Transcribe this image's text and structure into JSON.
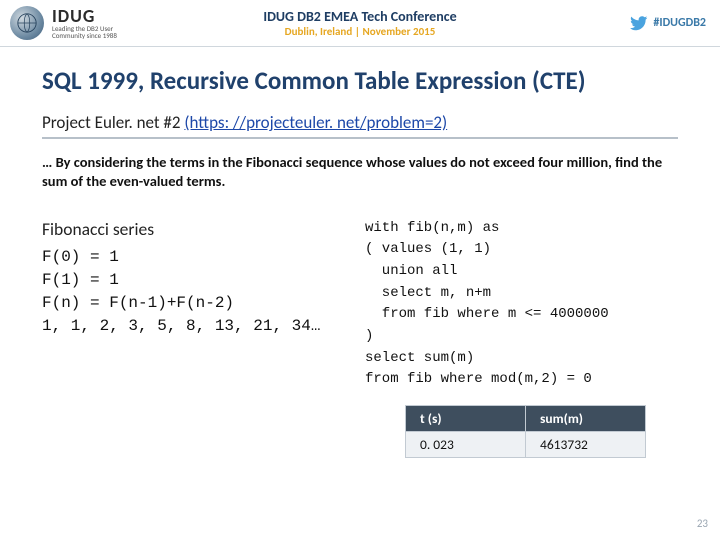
{
  "header": {
    "logo_big": "IDUG",
    "logo_sub1": "Leading the DB2 User",
    "logo_sub2": "Community since 1988",
    "title": "IDUG DB2 EMEA Tech Conference",
    "subtitle": "Dublin, Ireland  |  November 2015",
    "hashtag": "#IDUGDB2"
  },
  "main": {
    "h1": "SQL 1999, Recursive Common Table Expression (CTE)",
    "subtitle_prefix": "Project Euler. net #2 ",
    "link_text": "(https: //projecteuler. net/problem=2)",
    "problem": "… By considering the terms in the Fibonacci sequence whose values do not exceed four million, find the sum of the even-valued terms.",
    "fib_title": "Fibonacci series",
    "fib_lines": "F(0) = 1\nF(1) = 1\nF(n) = F(n-1)+F(n-2)\n1, 1, 2, 3, 5, 8, 13, 21, 34…",
    "sql": "with fib(n,m) as\n( values (1, 1)\n  union all\n  select m, n+m\n  from fib where m <= 4000000\n)\nselect sum(m)\nfrom fib where mod(m,2) = 0"
  },
  "result": {
    "h1": "t (s)",
    "h2": "sum(m)",
    "c1": "0. 023",
    "c2": "4613732"
  },
  "footer": {
    "page": "23"
  },
  "chart_data": {
    "type": "table",
    "title": "Recursive CTE Fibonacci even-sum result",
    "columns": [
      "t (s)",
      "sum(m)"
    ],
    "rows": [
      [
        "0.023",
        4613732
      ]
    ]
  }
}
